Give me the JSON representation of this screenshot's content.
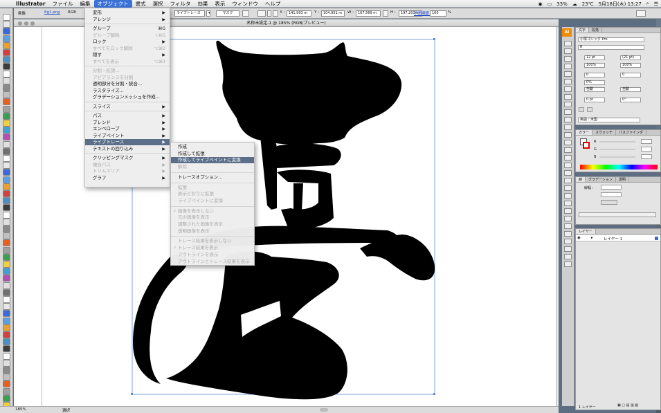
{
  "menubar": {
    "app": "Illustrator",
    "items": [
      "ファイル",
      "編集",
      "オブジェクト",
      "書式",
      "選択",
      "フィルタ",
      "効果",
      "表示",
      "ウィンドウ",
      "ヘルプ"
    ],
    "active_index": 2,
    "status": {
      "battery": "33%",
      "temp": "23℃",
      "clock": "5月18日(木) 13:27"
    }
  },
  "controlbar": {
    "label_image": "画像",
    "filename": "fig1.png",
    "colormode": "RGB",
    "livetrace_btn": "ライブトレース",
    "mask_btn": "マスク",
    "x_label": "X :",
    "x_value": "141.993 m",
    "y_label": "Y :",
    "y_value": "104.951 m",
    "w_label": "W :",
    "w_value": "167.569 m",
    "h_label": "H :",
    "h_value": "197.203 m",
    "opacity_label": "不透明度 :",
    "opacity_value": "100",
    "opacity_unit": "%"
  },
  "document": {
    "title": "名称未設定-1 @ 185% (RGB/プレビュー)"
  },
  "object_menu": {
    "items": [
      {
        "label": "変形",
        "arrow": "▶",
        "disabled": false
      },
      {
        "label": "アレンジ",
        "arrow": "▶",
        "disabled": false
      },
      {
        "label": "グループ",
        "shortcut": "⌘G",
        "disabled": false
      },
      {
        "label": "グループ解除",
        "shortcut": "⇧⌘G",
        "disabled": true
      },
      {
        "label": "ロック",
        "arrow": "▶",
        "disabled": false
      },
      {
        "label": "すべてをロック解除",
        "shortcut": "⌥⌘2",
        "disabled": true
      },
      {
        "label": "隠す",
        "arrow": "▶",
        "disabled": false
      },
      {
        "label": "すべてを表示",
        "shortcut": "⌥⌘3",
        "disabled": true
      },
      {
        "label": "分割・拡張...",
        "disabled": true
      },
      {
        "label": "アピアランスを分割",
        "disabled": true
      },
      {
        "label": "透明部分を分割・統合...",
        "disabled": false
      },
      {
        "label": "ラスタライズ...",
        "disabled": false
      },
      {
        "label": "グラデーションメッシュを作成...",
        "disabled": false
      },
      {
        "label": "スライス",
        "arrow": "▶",
        "disabled": false
      },
      {
        "label": "パス",
        "arrow": "▶",
        "disabled": false
      },
      {
        "label": "ブレンド",
        "arrow": "▶",
        "disabled": false
      },
      {
        "label": "エンベロープ",
        "arrow": "▶",
        "disabled": false
      },
      {
        "label": "ライブペイント",
        "arrow": "▶",
        "disabled": false
      },
      {
        "label": "ライブトレース",
        "arrow": "▶",
        "disabled": false
      },
      {
        "label": "テキストの回り込み",
        "arrow": "▶",
        "disabled": false
      },
      {
        "label": "クリッピングマスク",
        "arrow": "▶",
        "disabled": false
      },
      {
        "label": "複合パス",
        "arrow": "▶",
        "disabled": true
      },
      {
        "label": "トリムエリア",
        "arrow": "▶",
        "disabled": true
      },
      {
        "label": "グラフ",
        "arrow": "▶",
        "disabled": false
      }
    ]
  },
  "trace_submenu": {
    "items": [
      {
        "label": "作成",
        "disabled": false
      },
      {
        "label": "作成して拡張",
        "disabled": false
      },
      {
        "label": "作成してライブペイントに変換",
        "disabled": false
      },
      {
        "label": "解除",
        "disabled": true
      },
      {
        "label": "トレースオプション...",
        "disabled": false
      },
      {
        "label": "拡張",
        "disabled": true
      },
      {
        "label": "表示どおりに拡張",
        "disabled": true
      },
      {
        "label": "ライブペイントに変換",
        "disabled": true
      },
      {
        "label": "画像を表示しない",
        "check": "✓",
        "disabled": true
      },
      {
        "label": "元の画像を表示",
        "disabled": true
      },
      {
        "label": "調整された画像を表示",
        "disabled": true
      },
      {
        "label": "透明画像を表示",
        "disabled": true
      },
      {
        "label": "トレース結果を表示しない",
        "disabled": true
      },
      {
        "label": "トレース結果を表示",
        "check": "✓",
        "disabled": true
      },
      {
        "label": "アウトラインを表示",
        "disabled": true
      },
      {
        "label": "アウトラインとトレース結果を表示",
        "disabled": true
      }
    ]
  },
  "panels": {
    "char_tabs": [
      "文字",
      "段落"
    ],
    "font": "小塚ゴシック Pro",
    "style": "R",
    "size": "12 pt",
    "leading": "(21 pt)",
    "hscale": "100%",
    "vscale": "100%",
    "tracking": "0",
    "kerning": "0",
    "baseline": "0%",
    "auto1": "自動",
    "auto2": "自動",
    "shift": "0 pt",
    "rotate": "0°",
    "lang": "英語 : 米国",
    "color_tabs": [
      "カラー",
      "スウォッチ",
      "パスファインダ"
    ],
    "color_r": "R",
    "color_g": "G",
    "color_b": "B",
    "stroke_tabs": [
      "線",
      "グラデーション",
      "透明"
    ],
    "stroke_label": "線幅 :",
    "layer_tabs": [
      "レイヤー"
    ],
    "layer_name": "レイヤー 1",
    "layer_count": "1 レイヤー"
  },
  "bottom": {
    "zoom": "185%",
    "status": "選択"
  }
}
